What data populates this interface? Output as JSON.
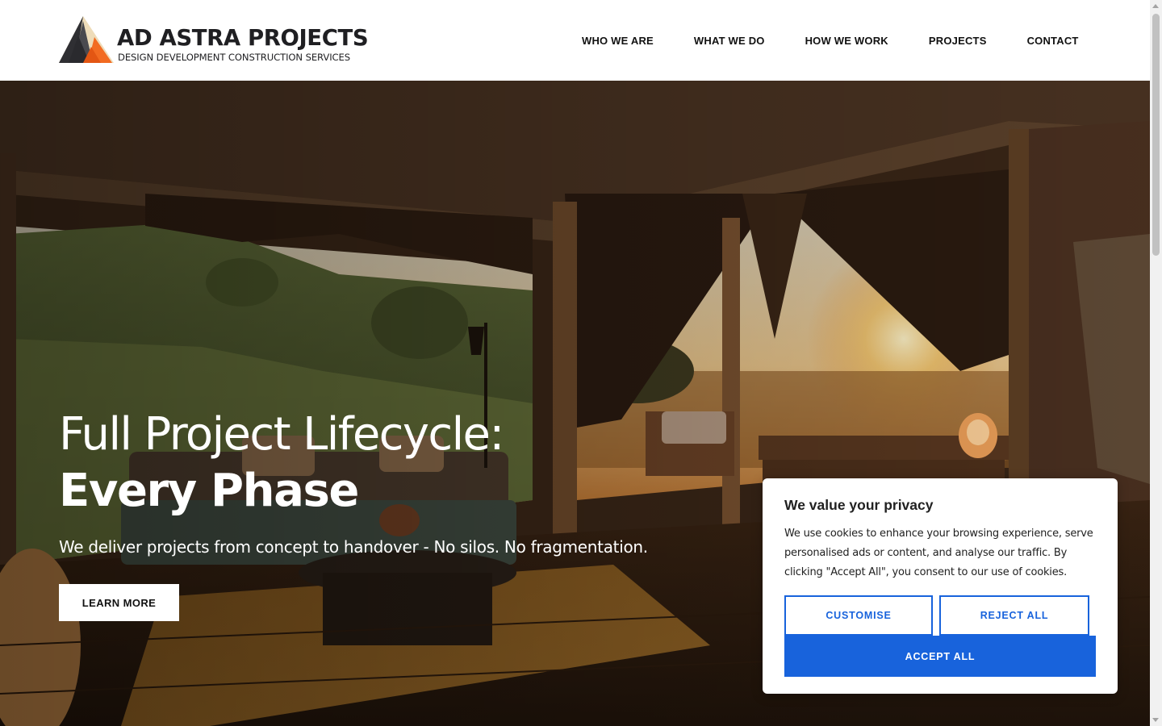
{
  "header": {
    "logo": {
      "name": "AD ASTRA PROJECTS",
      "tagline": "DESIGN DEVELOPMENT CONSTRUCTION SERVICES"
    },
    "nav": [
      {
        "label": "WHO WE ARE"
      },
      {
        "label": "WHAT WE DO"
      },
      {
        "label": "HOW WE WORK"
      },
      {
        "label": "PROJECTS"
      },
      {
        "label": "CONTACT"
      }
    ]
  },
  "hero": {
    "title_line1": "Full Project Lifecycle:",
    "title_line2": "Every Phase",
    "subtitle": "We deliver projects from concept to handover - No silos. No fragmentation.",
    "cta_label": "LEARN MORE"
  },
  "cookie_banner": {
    "title": "We value your privacy",
    "text": "We use cookies to enhance your browsing experience, serve personalised ads or content, and analyse our traffic. By clicking \"Accept All\", you consent to our use of cookies.",
    "customise_label": "CUSTOMISE",
    "reject_label": "REJECT ALL",
    "accept_label": "ACCEPT ALL"
  },
  "colors": {
    "accent": "#1863dc",
    "logo_orange": "#f26b21",
    "logo_dark": "#3a3a3e",
    "logo_sand": "#eedcb9"
  },
  "icons": {
    "logo_mark": "mountain-triangle-logo-icon"
  }
}
